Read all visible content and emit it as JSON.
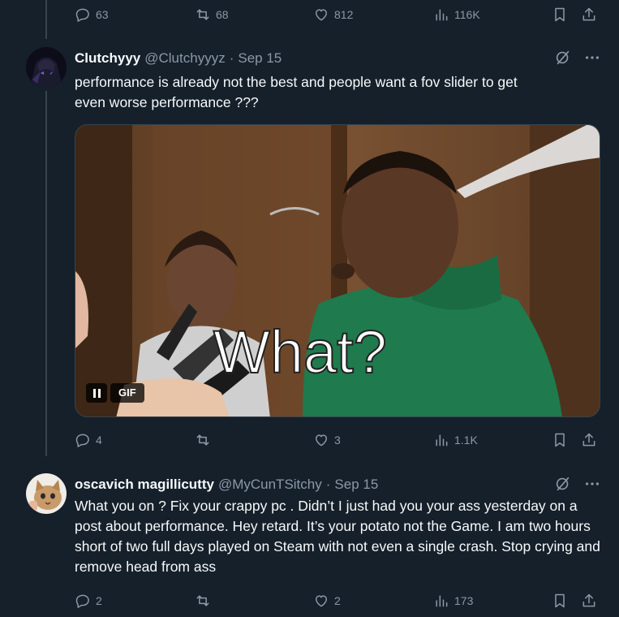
{
  "top_actions": {
    "replies": "63",
    "reposts": "68",
    "likes": "812",
    "views": "116K"
  },
  "tweet1": {
    "name": "Clutchyyy",
    "handle": "@Clutchyyyz",
    "separator": "·",
    "date": "Sep 15",
    "text_line1": "performance is already not the best and people want a fov slider to get",
    "text_line2": "even worse performance ???",
    "media": {
      "caption": "What?",
      "pause_icon": "pause-icon",
      "gif_label": "GIF"
    },
    "actions": {
      "replies": "4",
      "reposts": "",
      "likes": "3",
      "views": "1.1K"
    }
  },
  "tweet2": {
    "name": "oscavich magillicutty",
    "handle": "@MyCunTSitchy",
    "separator": "·",
    "date": "Sep 15",
    "text": "What you on ? Fix your crappy pc . Didn’t I just had you your ass yesterday on a post about performance. Hey retard. It’s your potato not the Game. I am two hours short of two full days played on Steam with not even a single crash. Stop crying and  remove head from ass",
    "actions": {
      "replies": "2",
      "reposts": "",
      "likes": "2",
      "views": "173"
    }
  },
  "colors": {
    "background": "#15202b",
    "text": "#f7f9f9",
    "muted": "#8b98a5",
    "border": "#38444d"
  }
}
